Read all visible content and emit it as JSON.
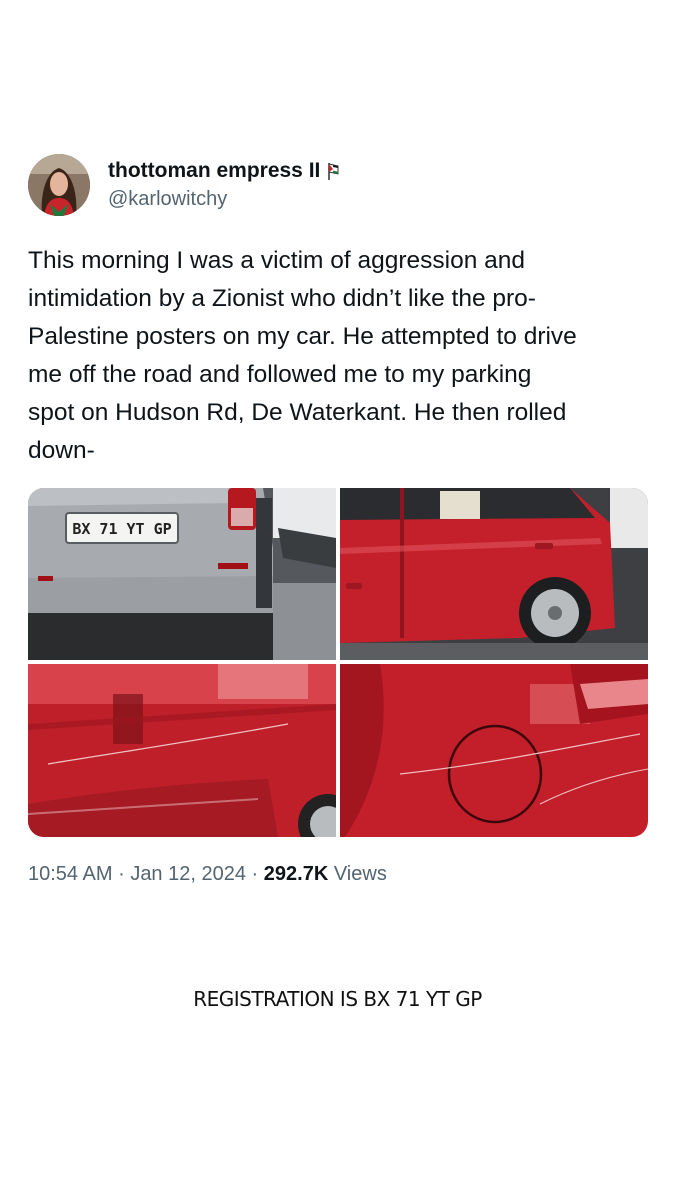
{
  "tweet": {
    "display_name": "thottoman empress II",
    "handle": "@karlowitchy",
    "flag_icon": "palestine-flag-icon",
    "text": "This morning I was a victim of aggression and\nintimidation by a Zionist who didn’t like the pro-\nPalestine posters on my car. He attempted to drive\nme off the road and followed me to my parking\nspot on Hudson Rd, De Waterkant. He then rolled\ndown-",
    "media": {
      "plate_text": "BX 71 YT GP",
      "photos": [
        "car-rear-licence-plate-photo",
        "red-car-side-photo",
        "scratched-red-door-photo",
        "scratched-fuel-cap-photo"
      ]
    },
    "time": "10:54 AM",
    "separator": "·",
    "date": "Jan 12, 2024",
    "views_count": "292.7K",
    "views_label": "Views"
  },
  "caption": "REGISTRATION IS BX 71 YT GP",
  "colors": {
    "text": "#0f1419",
    "secondary": "#536471",
    "car_red": "#c4202b"
  }
}
